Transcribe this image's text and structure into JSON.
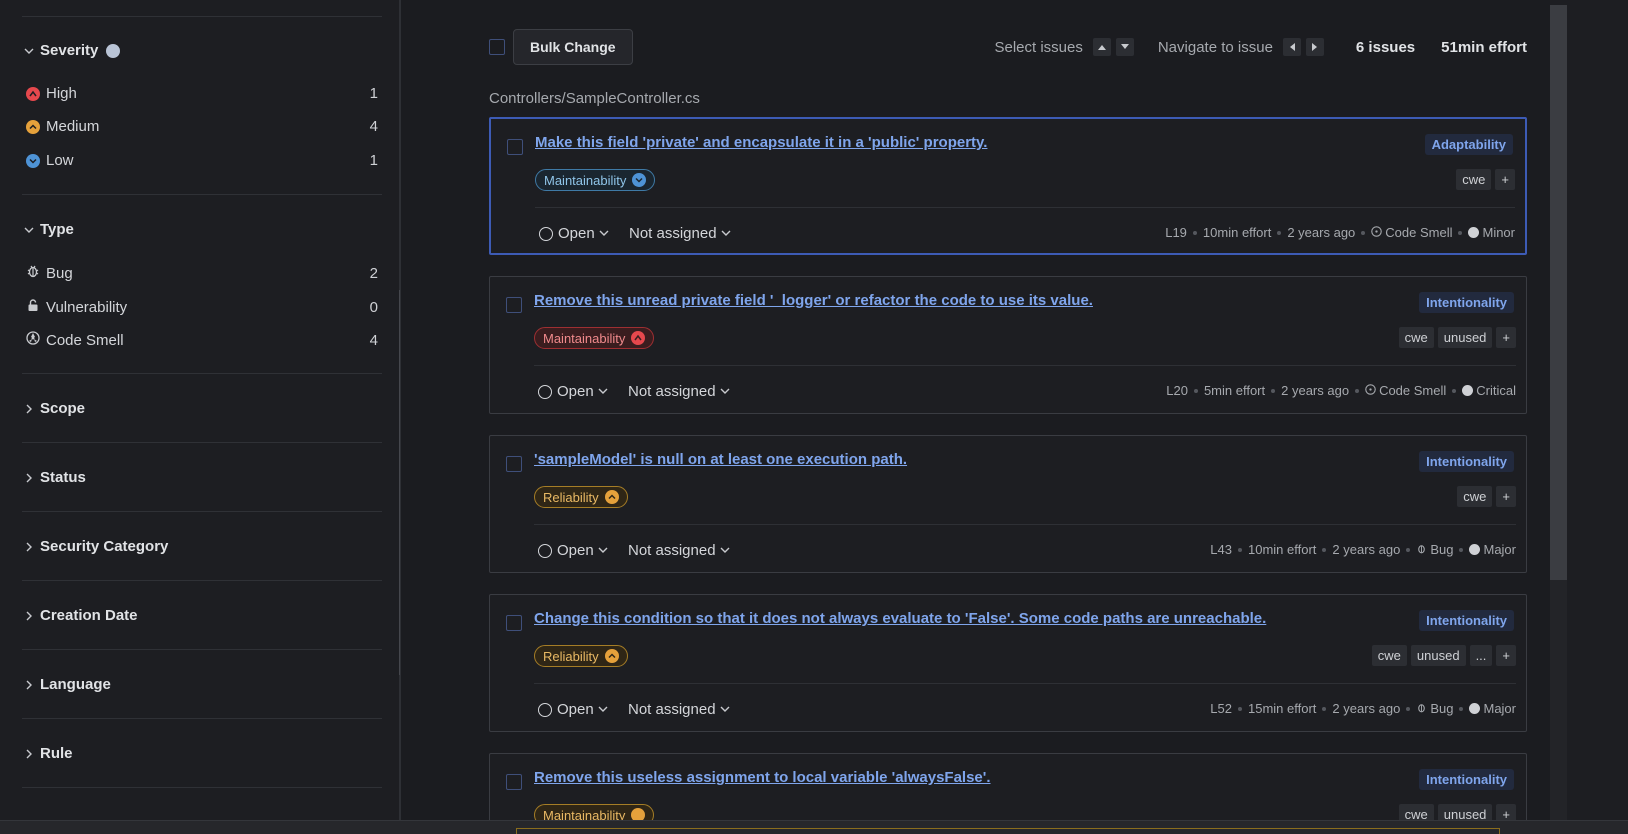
{
  "sidebar": {
    "severity": {
      "title": "Severity",
      "items": [
        {
          "label": "High",
          "count": "1",
          "color": "#e5484d"
        },
        {
          "label": "Medium",
          "count": "4",
          "color": "#e5a13b"
        },
        {
          "label": "Low",
          "count": "1",
          "color": "#4e93d6"
        }
      ]
    },
    "type": {
      "title": "Type",
      "items": [
        {
          "label": "Bug",
          "count": "2",
          "icon": "bug-icon"
        },
        {
          "label": "Vulnerability",
          "count": "0",
          "icon": "lock-icon"
        },
        {
          "label": "Code Smell",
          "count": "4",
          "icon": "code-smell-icon"
        }
      ]
    },
    "collapsed_facets": [
      "Scope",
      "Status",
      "Security Category",
      "Creation Date",
      "Language",
      "Rule"
    ]
  },
  "toolbar": {
    "bulk_change": "Bulk Change",
    "select_issues": "Select issues",
    "navigate_to_issue": "Navigate to issue",
    "issues_count": "6 issues",
    "effort": "51min effort"
  },
  "file_path": "Controllers/SampleController.cs",
  "issues": [
    {
      "title": "Make this field 'private' and encapsulate it in a 'public' property.",
      "attribute": "Adaptability",
      "quality": "Maintainability",
      "tags": [
        "cwe",
        "+"
      ],
      "status": "Open",
      "assignee": "Not assigned",
      "line": "L19",
      "effort": "10min effort",
      "age": "2 years ago",
      "type": "Code Smell",
      "severity": "Minor"
    },
    {
      "title": "Remove this unread private field '_logger' or refactor the code to use its value.",
      "attribute": "Intentionality",
      "quality": "Maintainability",
      "tags": [
        "cwe",
        "unused",
        "+"
      ],
      "status": "Open",
      "assignee": "Not assigned",
      "line": "L20",
      "effort": "5min effort",
      "age": "2 years ago",
      "type": "Code Smell",
      "severity": "Critical"
    },
    {
      "title": "'sampleModel' is null on at least one execution path.",
      "attribute": "Intentionality",
      "quality": "Reliability",
      "tags": [
        "cwe",
        "+"
      ],
      "status": "Open",
      "assignee": "Not assigned",
      "line": "L43",
      "effort": "10min effort",
      "age": "2 years ago",
      "type": "Bug",
      "severity": "Major"
    },
    {
      "title": "Change this condition so that it does not always evaluate to 'False'. Some code paths are unreachable.",
      "attribute": "Intentionality",
      "quality": "Reliability",
      "tags": [
        "cwe",
        "unused",
        "...",
        "+"
      ],
      "status": "Open",
      "assignee": "Not assigned",
      "line": "L52",
      "effort": "15min effort",
      "age": "2 years ago",
      "type": "Bug",
      "severity": "Major"
    },
    {
      "title": "Remove this useless assignment to local variable 'alwaysFalse'.",
      "attribute": "Intentionality",
      "quality": "Maintainability",
      "tags": [
        "cwe",
        "unused",
        "+"
      ]
    }
  ]
}
